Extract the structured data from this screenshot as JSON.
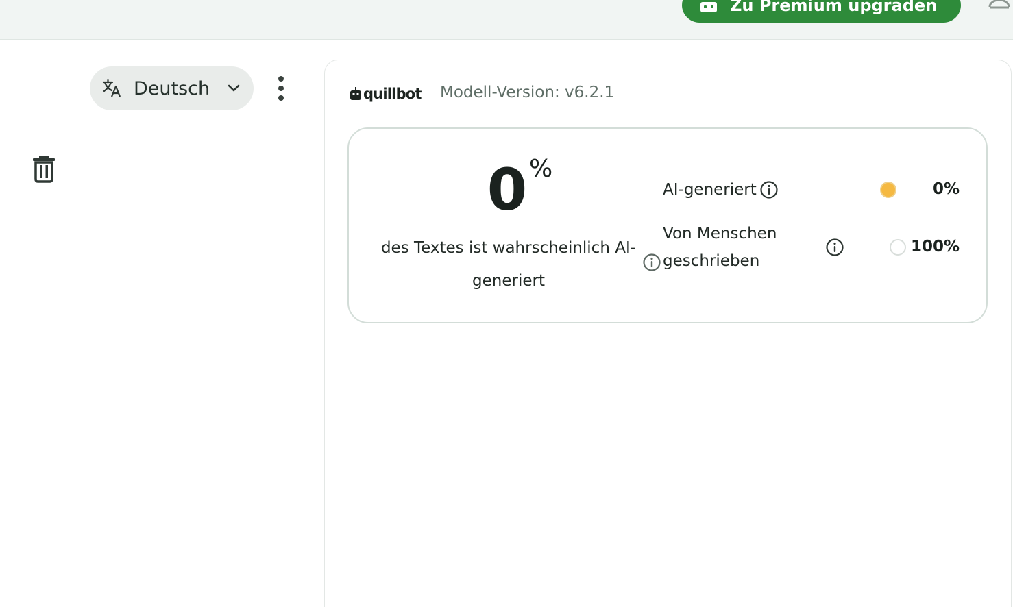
{
  "header": {
    "upgrade_label": "Zu Premium upgraden",
    "upgrade_color": "#2e8b3a",
    "icons": [
      "gift-icon",
      "account-icon"
    ]
  },
  "left_panel": {
    "language_label": "Deutsch",
    "icons": [
      "translate-icon",
      "chevron-down-icon",
      "more-vertical-icon",
      "trash-icon"
    ]
  },
  "result": {
    "brand": "quillbot",
    "model_version": "Modell-Version: v6.2.1",
    "score_value": "0",
    "score_unit": "%",
    "score_caption": "des Textes ist wahrscheinlich AI-generiert",
    "rows": [
      {
        "label": "AI-generiert",
        "value": "0%",
        "color": "#f5b942"
      },
      {
        "label": "Von Menschen geschrieben",
        "value": "100%",
        "color": "#ffffff"
      }
    ]
  }
}
